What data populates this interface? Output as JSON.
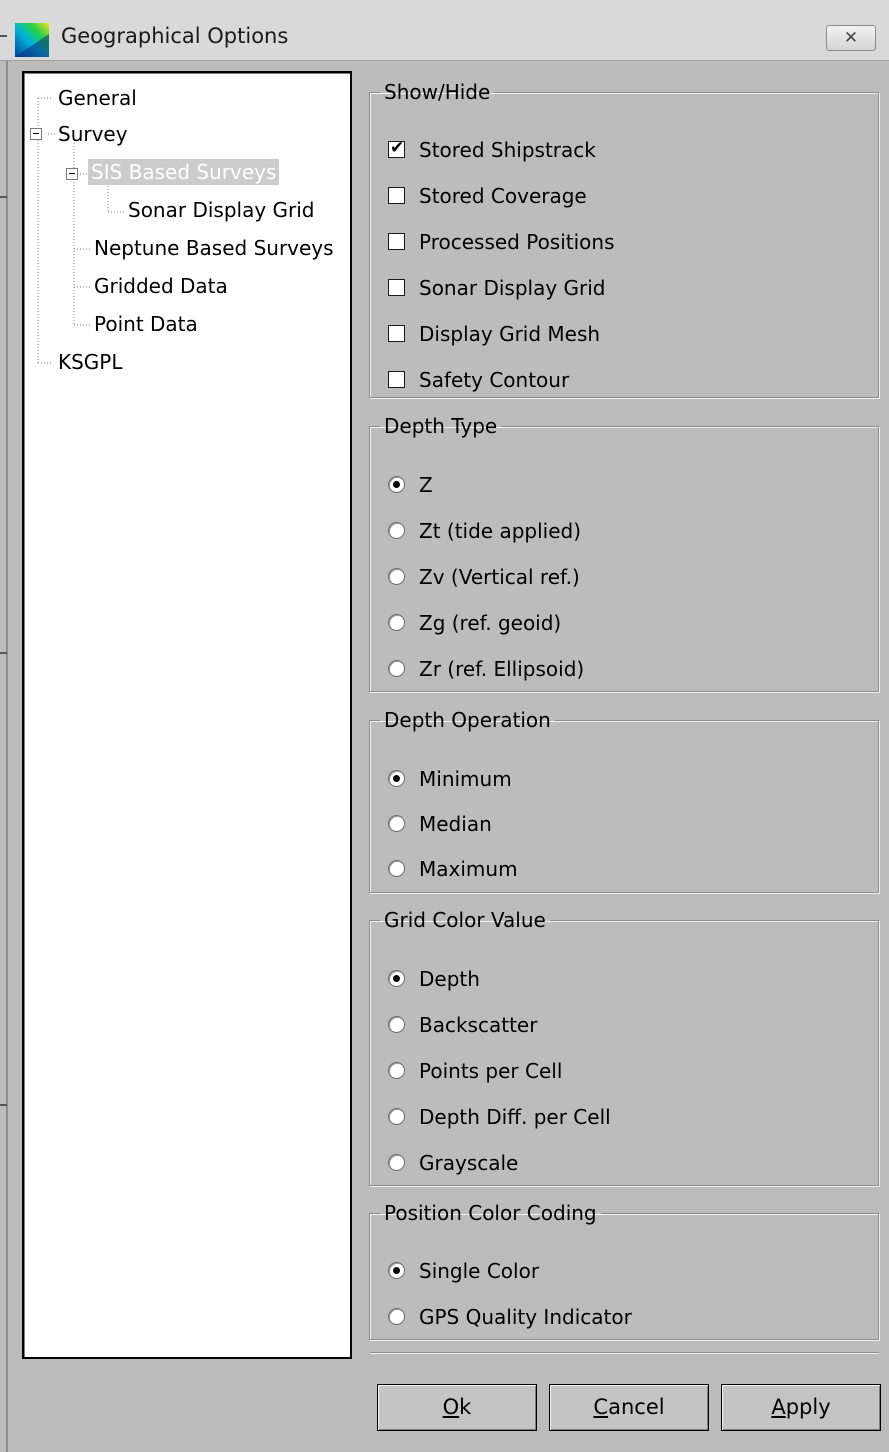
{
  "window": {
    "title": "Geographical Options",
    "close_glyph": "✕"
  },
  "tree": {
    "items": [
      {
        "label": "General"
      },
      {
        "label": "Survey"
      },
      {
        "label": "SIS Based Surveys"
      },
      {
        "label": "Sonar Display Grid"
      },
      {
        "label": "Neptune Based Surveys"
      },
      {
        "label": "Gridded Data"
      },
      {
        "label": "Point Data"
      },
      {
        "label": "KSGPL"
      }
    ],
    "selected": "SIS Based Surveys"
  },
  "show_hide": {
    "title": "Show/Hide",
    "options": [
      {
        "label": "Stored Shipstrack",
        "checked": true
      },
      {
        "label": "Stored Coverage",
        "checked": false
      },
      {
        "label": "Processed Positions",
        "checked": false
      },
      {
        "label": "Sonar Display Grid",
        "checked": false
      },
      {
        "label": "Display Grid Mesh",
        "checked": false
      },
      {
        "label": "Safety Contour",
        "checked": false
      }
    ]
  },
  "depth_type": {
    "title": "Depth Type",
    "options": [
      "Z",
      "Zt (tide applied)",
      "Zv (Vertical ref.)",
      "Zg (ref. geoid)",
      "Zr (ref. Ellipsoid)"
    ],
    "selected": "Z"
  },
  "depth_operation": {
    "title": "Depth Operation",
    "options": [
      "Minimum",
      "Median",
      "Maximum"
    ],
    "selected": "Minimum"
  },
  "grid_color_value": {
    "title": "Grid Color Value",
    "options": [
      "Depth",
      "Backscatter",
      "Points per Cell",
      "Depth Diff. per Cell",
      "Grayscale"
    ],
    "selected": "Depth"
  },
  "position_color_coding": {
    "title": "Position Color Coding",
    "options": [
      "Single Color",
      "GPS Quality Indicator"
    ],
    "selected": "Single Color"
  },
  "buttons": {
    "ok": {
      "accel": "O",
      "rest": "k"
    },
    "cancel": {
      "accel": "C",
      "rest": "ancel"
    },
    "apply": {
      "accel": "A",
      "rest": "pply"
    }
  },
  "colors": {
    "selection": "#cccccc",
    "dialog_bg": "#bdbdbd"
  }
}
